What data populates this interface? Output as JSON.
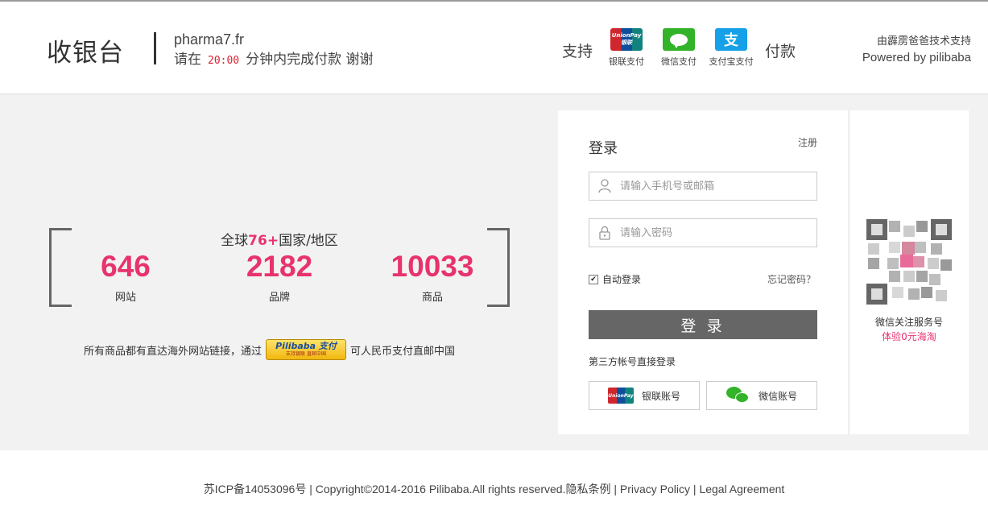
{
  "header": {
    "brand": "收银台",
    "site": "pharma7.fr",
    "timer_prefix": "请在",
    "countdown": "20:00",
    "timer_suffix": "分钟内完成付款  谢谢",
    "support_label": "支持",
    "payments": [
      {
        "label": "银联支付",
        "icon": "unionpay-icon",
        "icon_text": "UnionPay 银联"
      },
      {
        "label": "微信支付",
        "icon": "wechat-pay-icon"
      },
      {
        "label": "支付宝支付",
        "icon": "alipay-icon",
        "icon_text": "支"
      }
    ],
    "pay_end_label": "付款",
    "tech_support": "由霹雳爸爸技术支持",
    "powered_by": "Powered by pilibaba"
  },
  "stats": {
    "title_prefix": "全球",
    "title_highlight": "76+",
    "title_suffix": "国家/地区",
    "items": [
      {
        "number": "646",
        "label": "网站"
      },
      {
        "number": "2182",
        "label": "品牌"
      },
      {
        "number": "10033",
        "label": "商品"
      }
    ],
    "intro_prefix": "所有商品都有直达海外网站链接，通过",
    "badge_title": "Pilibaba 支付",
    "badge_sub": "支持银联  直邮中国",
    "intro_suffix": "可人民币支付直邮中国"
  },
  "login": {
    "title": "登录",
    "register": "注册",
    "phone_placeholder": "请输入手机号或邮箱",
    "password_placeholder": "请输入密码",
    "auto_login": "自动登录",
    "auto_login_checked": true,
    "forgot": "忘记密码？",
    "button": "登 录",
    "third_party_label": "第三方帐号直接登录",
    "unionpay_account": "银联账号",
    "wechat_account": "微信账号"
  },
  "qr": {
    "title": "微信关注服务号",
    "subtitle": "体验0元海淘"
  },
  "footer": {
    "icp": "苏ICP备14053096号 | Copyright©2014-2016 Pilibaba.All rights reserved.",
    "privacy_cn": "隐私条例",
    "sep": " | ",
    "privacy_en": "Privacy Policy",
    "legal": "Legal Agreement"
  },
  "colors": {
    "accent": "#e8336d",
    "countdown": "#d9232d",
    "button": "#666666",
    "background": "#f2f2f2"
  }
}
